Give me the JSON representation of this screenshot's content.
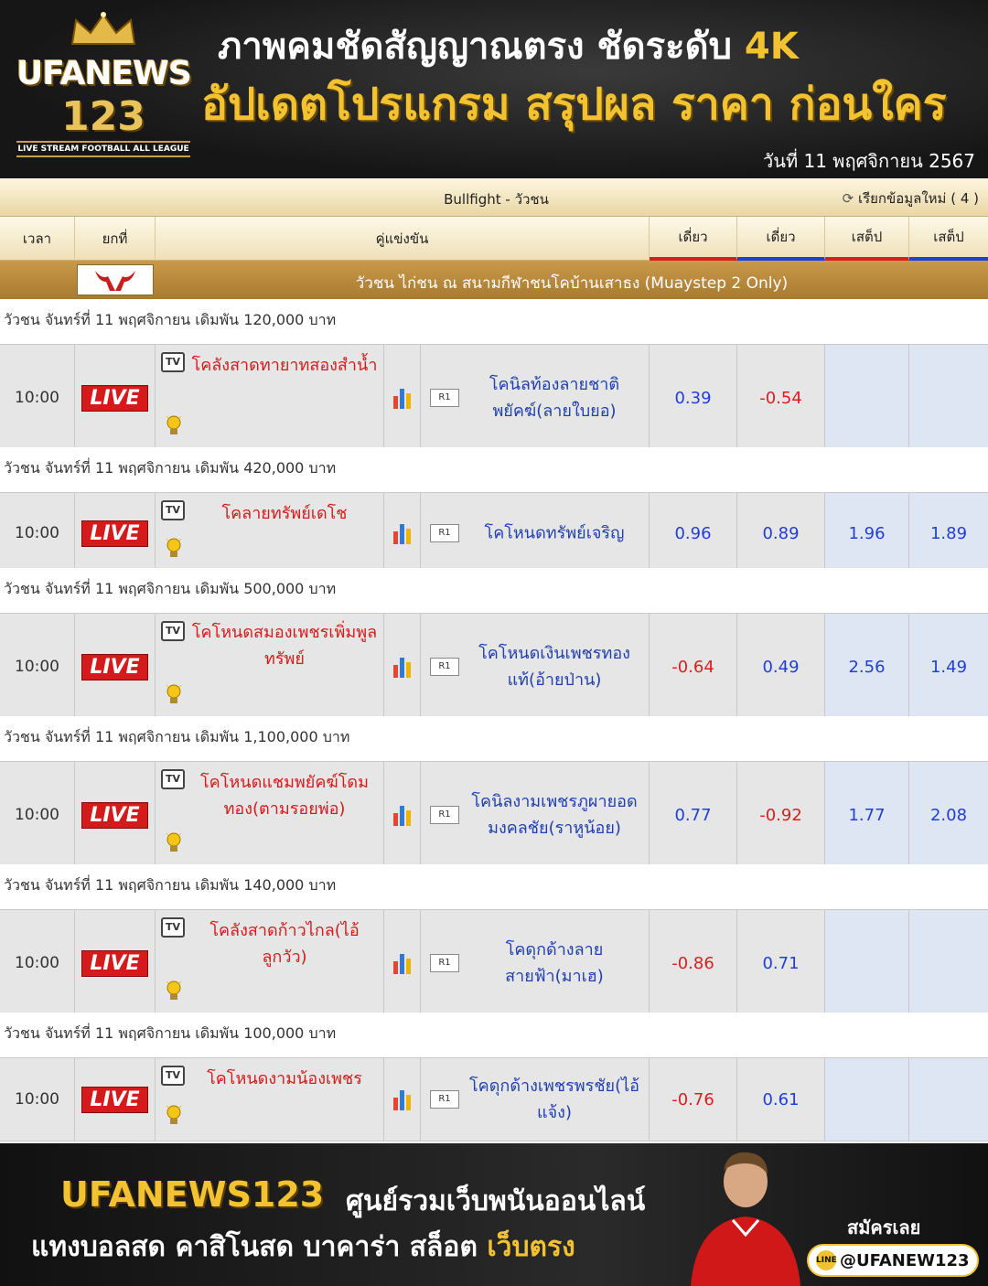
{
  "header": {
    "logo_line1": "UFANEWS",
    "logo_line2": "123",
    "logo_line3": "LIVE STREAM FOOTBALL ALL LEAGUE",
    "headline1_text": "ภาพคมชัดสัญญาณตรง ชัดระดับ ",
    "headline1_accent": "4K",
    "headline2": "อัปเดตโปรแกรม สรุปผล ราคา ก่อนใคร",
    "date": "วันที่  11 พฤศจิกายน 2567"
  },
  "table": {
    "title": "Bullfight - วัวชน",
    "refresh_label": "เรียกข้อมูลใหม่ ( 4 )",
    "columns": {
      "time": "เวลา",
      "round": "ยกที่",
      "match": "คู่แข่งขัน",
      "single1": "เดี่ยว",
      "single2": "เดี่ยว",
      "step1": "เสต็ป",
      "step2": "เสต็ป"
    },
    "league_name": "วัวชน ไก่ชน ณ สนามกีฬาชนโคบ้านเสาธง (Muaystep 2 Only)",
    "live_label": "LIVE",
    "tv_label": "TV",
    "round_label": "R1",
    "matches": [
      {
        "bet": "วัวชน จันทร์ที่ 11 พฤศจิกายน เดิมพัน 120,000 บาท",
        "time": "10:00",
        "home": "โคลังสาดทายาทสองสำน้ำ",
        "away": "โคนิลท้องลายชาติพยัคฆ์(ลายใบยอ)",
        "o1": "0.39",
        "o2": "-0.54",
        "o3": "",
        "o4": ""
      },
      {
        "bet": "วัวชน จันทร์ที่ 11 พฤศจิกายน เดิมพัน 420,000 บาท",
        "time": "10:00",
        "home": "โคลายทรัพย์เดโช",
        "away": "โคโหนดทรัพย์เจริญ",
        "o1": "0.96",
        "o2": "0.89",
        "o3": "1.96",
        "o4": "1.89"
      },
      {
        "bet": "วัวชน จันทร์ที่ 11 พฤศจิกายน เดิมพัน 500,000 บาท",
        "time": "10:00",
        "home": "โคโหนดสมองเพชรเพิ่มพูลทรัพย์",
        "away": "โคโหนดเงินเพชรทองแท้(อ้ายป่าน)",
        "o1": "-0.64",
        "o2": "0.49",
        "o3": "2.56",
        "o4": "1.49"
      },
      {
        "bet": "วัวชน จันทร์ที่ 11 พฤศจิกายน เดิมพัน 1,100,000 บาท",
        "time": "10:00",
        "home": "โคโหนดแชมพยัคฆ์โดมทอง(ตามรอยพ่อ)",
        "away": "โคนิลงามเพชรภูผายอดมงคลชัย(ราหูน้อย)",
        "o1": "0.77",
        "o2": "-0.92",
        "o3": "1.77",
        "o4": "2.08"
      },
      {
        "bet": "วัวชน จันทร์ที่ 11 พฤศจิกายน เดิมพัน 140,000 บาท",
        "time": "10:00",
        "home": "โคลังสาดก้าวไกล(ไอ้ลูกวัว)",
        "away": "โคดุกด้างลายสายฟ้า(มาเฮ)",
        "o1": "-0.86",
        "o2": "0.71",
        "o3": "",
        "o4": ""
      },
      {
        "bet": "วัวชน จันทร์ที่ 11 พฤศจิกายน เดิมพัน 100,000 บาท",
        "time": "10:00",
        "home": "โคโหนดงามน้องเพชร",
        "away": "โคดุกด้างเพชรพรชัย(ไอ้แจ้ง)",
        "o1": "-0.76",
        "o2": "0.61",
        "o3": "",
        "o4": ""
      }
    ]
  },
  "footer": {
    "brand": "UFANEWS123",
    "tagline": "ศูนย์รวมเว็บพนันออนไลน์",
    "line2_text": "แทงบอลสด คาสิโนสด บาคาร่า สล็อต ",
    "line2_accent": "เว็บตรง",
    "signup": "สมัครเลย",
    "line_id": "@UFANEW123",
    "line_icon_text": "LINE"
  },
  "colors": {
    "accent_gold": "#f2c230",
    "live_red": "#d41a1a",
    "positive_odd": "#1f3fd7",
    "negative_odd": "#d71f1f"
  }
}
